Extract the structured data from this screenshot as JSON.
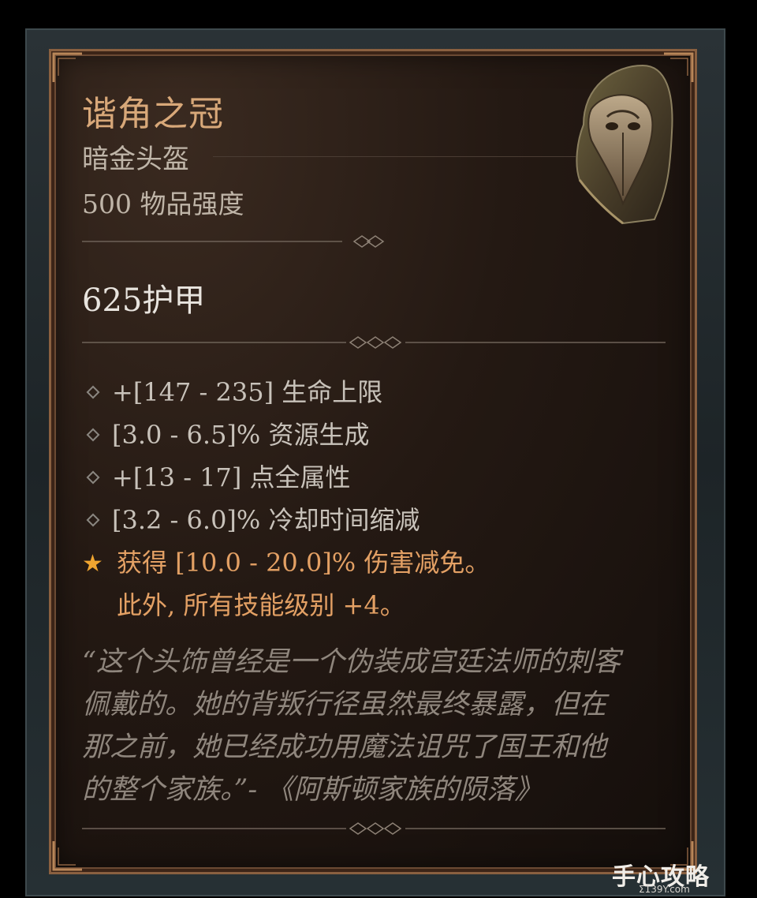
{
  "item": {
    "name": "谐角之冠",
    "type": "暗金头盔",
    "item_power": "500 物品强度",
    "armor": "625护甲",
    "icon": "hooded-helmet-icon"
  },
  "affixes": [
    "+[147 - 235] 生命上限",
    "[3.0 - 6.5]% 资源生成",
    "+[13 - 17] 点全属性",
    "[3.2 - 6.0]% 冷却时间缩减"
  ],
  "legendary": {
    "line1": "获得 [10.0 - 20.0]% 伤害减免。",
    "line2": "此外, 所有技能级别 +4。",
    "icon": "star-icon"
  },
  "flavor": {
    "lines": [
      "“这个头饰曾经是一个伪装成宫廷法师的刺客",
      "佩戴的。她的背叛行径虽然最终暴露，但在",
      "那之前，她已经成功用魔法诅咒了国王和他",
      "的整个家族。”- 《阿斯顿家族的陨落》"
    ]
  },
  "watermark": {
    "text": "手心攻略",
    "url": "Σ139Y.com"
  },
  "colors": {
    "title": "#d8a879",
    "legendary": "#e3a064",
    "star": "#f0a530",
    "frame_border": "#8a6040"
  }
}
